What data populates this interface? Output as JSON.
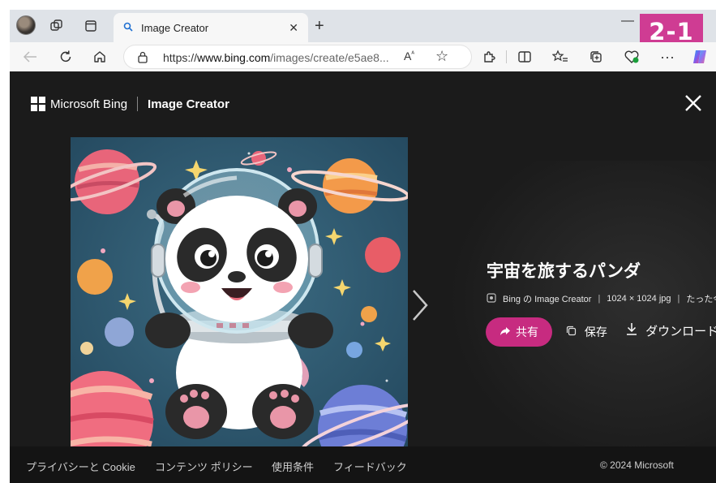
{
  "browser": {
    "tab_title": "Image Creator",
    "address": {
      "scheme": "https://",
      "host": "www.bing.com",
      "rest": "/images/create/e5ae8..."
    },
    "read_aloud_label": "Aᴬ"
  },
  "badge": "2-1",
  "viewer": {
    "brand": "Microsoft Bing",
    "product": "Image Creator",
    "image_title": "宇宙を旅するパンダ",
    "meta": {
      "source": "Bing の Image Creator",
      "size": "1024 × 1024 jpg",
      "time": "たった今"
    },
    "share_label": "共有",
    "save_label": "保存",
    "download_label": "ダウンロード"
  },
  "footer": {
    "privacy": "プライバシーと Cookie",
    "content_policy": "コンテンツ ポリシー",
    "terms": "使用条件",
    "feedback": "フィードバック",
    "copyright": "© 2024 Microsoft"
  },
  "colors": {
    "accent": "#c72b80",
    "badge": "#cf3c93",
    "viewer_bg": "#1b1b1b"
  }
}
